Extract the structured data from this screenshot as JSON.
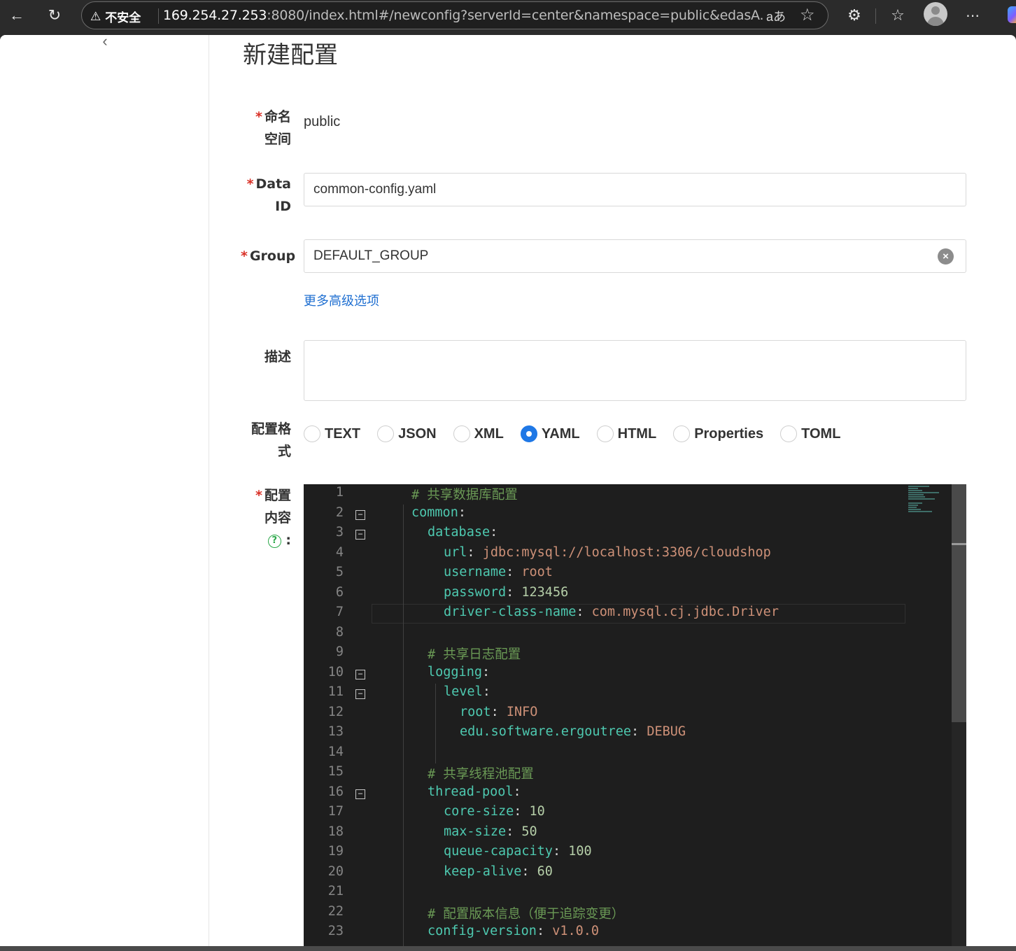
{
  "browser": {
    "security_label": "不安全",
    "url_host": "169.254.27.253",
    "url_rest": ":8080/index.html#/newconfig?serverId=center&namespace=public&edasA..."
  },
  "page": {
    "title": "新建配置"
  },
  "form": {
    "namespace": {
      "label_line1": "命名",
      "label_line2": "空间",
      "value": "public"
    },
    "data_id": {
      "label_line1": "Data",
      "label_line2": "ID",
      "value": "common-config.yaml"
    },
    "group": {
      "label": "Group",
      "value": "DEFAULT_GROUP"
    },
    "advanced_link": "更多高级选项",
    "description": {
      "label": "描述",
      "value": ""
    },
    "format": {
      "label_line1": "配置格",
      "label_line2": "式",
      "options": [
        "TEXT",
        "JSON",
        "XML",
        "YAML",
        "HTML",
        "Properties",
        "TOML"
      ],
      "selected": "YAML"
    },
    "content": {
      "label_line1": "配置",
      "label_line2": "内容",
      "colon": ":"
    }
  },
  "editor": {
    "lines": [
      {
        "n": "1",
        "fold": false,
        "indent": 0,
        "tokens": [
          {
            "t": "# 共享数据库配置",
            "c": "com"
          }
        ]
      },
      {
        "n": "2",
        "fold": true,
        "indent": 0,
        "tokens": [
          {
            "t": "common",
            "c": "key"
          },
          {
            "t": ":",
            "c": "pun"
          }
        ]
      },
      {
        "n": "3",
        "fold": true,
        "indent": 1,
        "tokens": [
          {
            "t": "database",
            "c": "key"
          },
          {
            "t": ":",
            "c": "pun"
          }
        ]
      },
      {
        "n": "4",
        "fold": false,
        "indent": 2,
        "tokens": [
          {
            "t": "url",
            "c": "key"
          },
          {
            "t": ": ",
            "c": "pun"
          },
          {
            "t": "jdbc:mysql://localhost:3306/cloudshop",
            "c": "str"
          }
        ]
      },
      {
        "n": "5",
        "fold": false,
        "indent": 2,
        "tokens": [
          {
            "t": "username",
            "c": "key"
          },
          {
            "t": ": ",
            "c": "pun"
          },
          {
            "t": "root",
            "c": "str"
          }
        ]
      },
      {
        "n": "6",
        "fold": false,
        "indent": 2,
        "tokens": [
          {
            "t": "password",
            "c": "key"
          },
          {
            "t": ": ",
            "c": "pun"
          },
          {
            "t": "123456",
            "c": "num"
          }
        ]
      },
      {
        "n": "7",
        "fold": false,
        "indent": 2,
        "tokens": [
          {
            "t": "driver-class-name",
            "c": "key"
          },
          {
            "t": ": ",
            "c": "pun"
          },
          {
            "t": "com.mysql.cj.jdbc.Driver",
            "c": "str"
          }
        ]
      },
      {
        "n": "8",
        "fold": false,
        "indent": 0,
        "tokens": []
      },
      {
        "n": "9",
        "fold": false,
        "indent": 1,
        "tokens": [
          {
            "t": "# 共享日志配置",
            "c": "com"
          }
        ]
      },
      {
        "n": "10",
        "fold": true,
        "indent": 1,
        "tokens": [
          {
            "t": "logging",
            "c": "key"
          },
          {
            "t": ":",
            "c": "pun"
          }
        ]
      },
      {
        "n": "11",
        "fold": true,
        "indent": 2,
        "tokens": [
          {
            "t": "level",
            "c": "key"
          },
          {
            "t": ":",
            "c": "pun"
          }
        ]
      },
      {
        "n": "12",
        "fold": false,
        "indent": 3,
        "tokens": [
          {
            "t": "root",
            "c": "key"
          },
          {
            "t": ": ",
            "c": "pun"
          },
          {
            "t": "INFO",
            "c": "str"
          }
        ]
      },
      {
        "n": "13",
        "fold": false,
        "indent": 3,
        "tokens": [
          {
            "t": "edu.software.ergoutree",
            "c": "key"
          },
          {
            "t": ": ",
            "c": "pun"
          },
          {
            "t": "DEBUG",
            "c": "str"
          }
        ]
      },
      {
        "n": "14",
        "fold": false,
        "indent": 0,
        "tokens": []
      },
      {
        "n": "15",
        "fold": false,
        "indent": 1,
        "tokens": [
          {
            "t": "# 共享线程池配置",
            "c": "com"
          }
        ]
      },
      {
        "n": "16",
        "fold": true,
        "indent": 1,
        "tokens": [
          {
            "t": "thread-pool",
            "c": "key"
          },
          {
            "t": ":",
            "c": "pun"
          }
        ]
      },
      {
        "n": "17",
        "fold": false,
        "indent": 2,
        "tokens": [
          {
            "t": "core-size",
            "c": "key"
          },
          {
            "t": ": ",
            "c": "pun"
          },
          {
            "t": "10",
            "c": "num"
          }
        ]
      },
      {
        "n": "18",
        "fold": false,
        "indent": 2,
        "tokens": [
          {
            "t": "max-size",
            "c": "key"
          },
          {
            "t": ": ",
            "c": "pun"
          },
          {
            "t": "50",
            "c": "num"
          }
        ]
      },
      {
        "n": "19",
        "fold": false,
        "indent": 2,
        "tokens": [
          {
            "t": "queue-capacity",
            "c": "key"
          },
          {
            "t": ": ",
            "c": "pun"
          },
          {
            "t": "100",
            "c": "num"
          }
        ]
      },
      {
        "n": "20",
        "fold": false,
        "indent": 2,
        "tokens": [
          {
            "t": "keep-alive",
            "c": "key"
          },
          {
            "t": ": ",
            "c": "pun"
          },
          {
            "t": "60",
            "c": "num"
          }
        ]
      },
      {
        "n": "21",
        "fold": false,
        "indent": 0,
        "tokens": []
      },
      {
        "n": "22",
        "fold": false,
        "indent": 1,
        "tokens": [
          {
            "t": "# 配置版本信息（便于追踪变更）",
            "c": "com"
          }
        ]
      },
      {
        "n": "23",
        "fold": false,
        "indent": 1,
        "tokens": [
          {
            "t": "config-version",
            "c": "key"
          },
          {
            "t": ": ",
            "c": "pun"
          },
          {
            "t": "v1.0.0",
            "c": "str"
          }
        ]
      }
    ]
  },
  "colors": {
    "accent": "#1f78e6",
    "required": "#d93026",
    "link": "#1f6fd1",
    "help": "#2ca84a"
  },
  "icons": [
    "back-arrow-icon",
    "refresh-icon",
    "warning-icon",
    "translate-icon",
    "star-icon",
    "extensions-icon",
    "favorites-icon",
    "avatar",
    "more-icon",
    "chevron-left-icon",
    "clear-icon",
    "help-icon",
    "fold-icon"
  ]
}
